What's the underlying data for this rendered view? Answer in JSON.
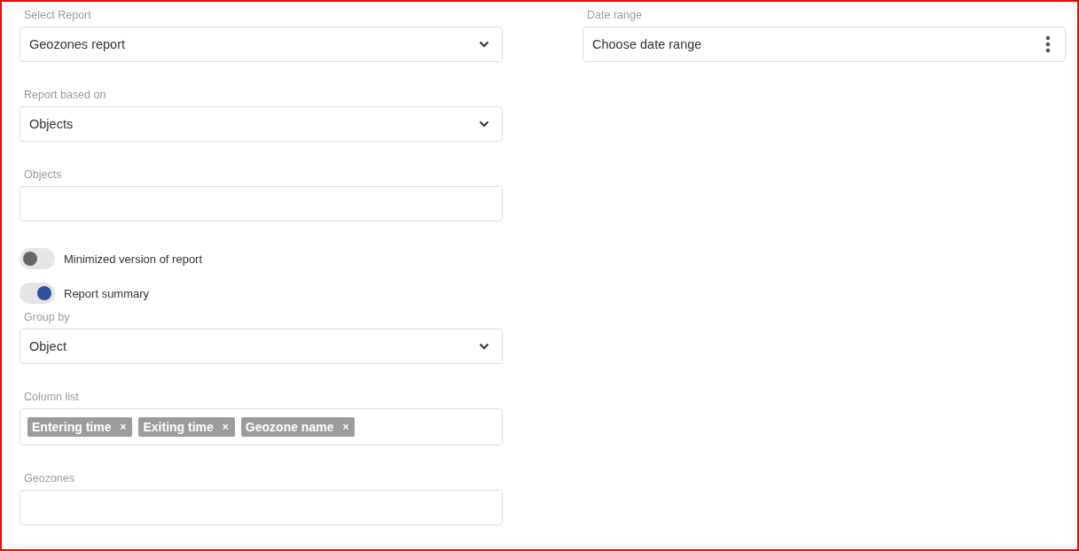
{
  "left_fields": [
    {
      "kind": "select",
      "label": "Select Report",
      "value": "Geozones report"
    },
    {
      "kind": "select",
      "label": "Report based on",
      "value": "Objects"
    },
    {
      "kind": "text",
      "label": "Objects"
    },
    {
      "kind": "toggle",
      "label": "Minimized version of report",
      "on": false
    },
    {
      "kind": "toggle",
      "label": "Report summary",
      "on": true
    },
    {
      "kind": "select",
      "label": "Group by",
      "value": "Object"
    },
    {
      "kind": "tags",
      "label": "Column list",
      "tags": [
        "Entering time",
        "Exiting time",
        "Geozone name"
      ],
      "remove_symbol": "×"
    },
    {
      "kind": "text",
      "label": "Geozones"
    }
  ],
  "date_range": {
    "label": "Date range",
    "placeholder": "Choose date range"
  }
}
